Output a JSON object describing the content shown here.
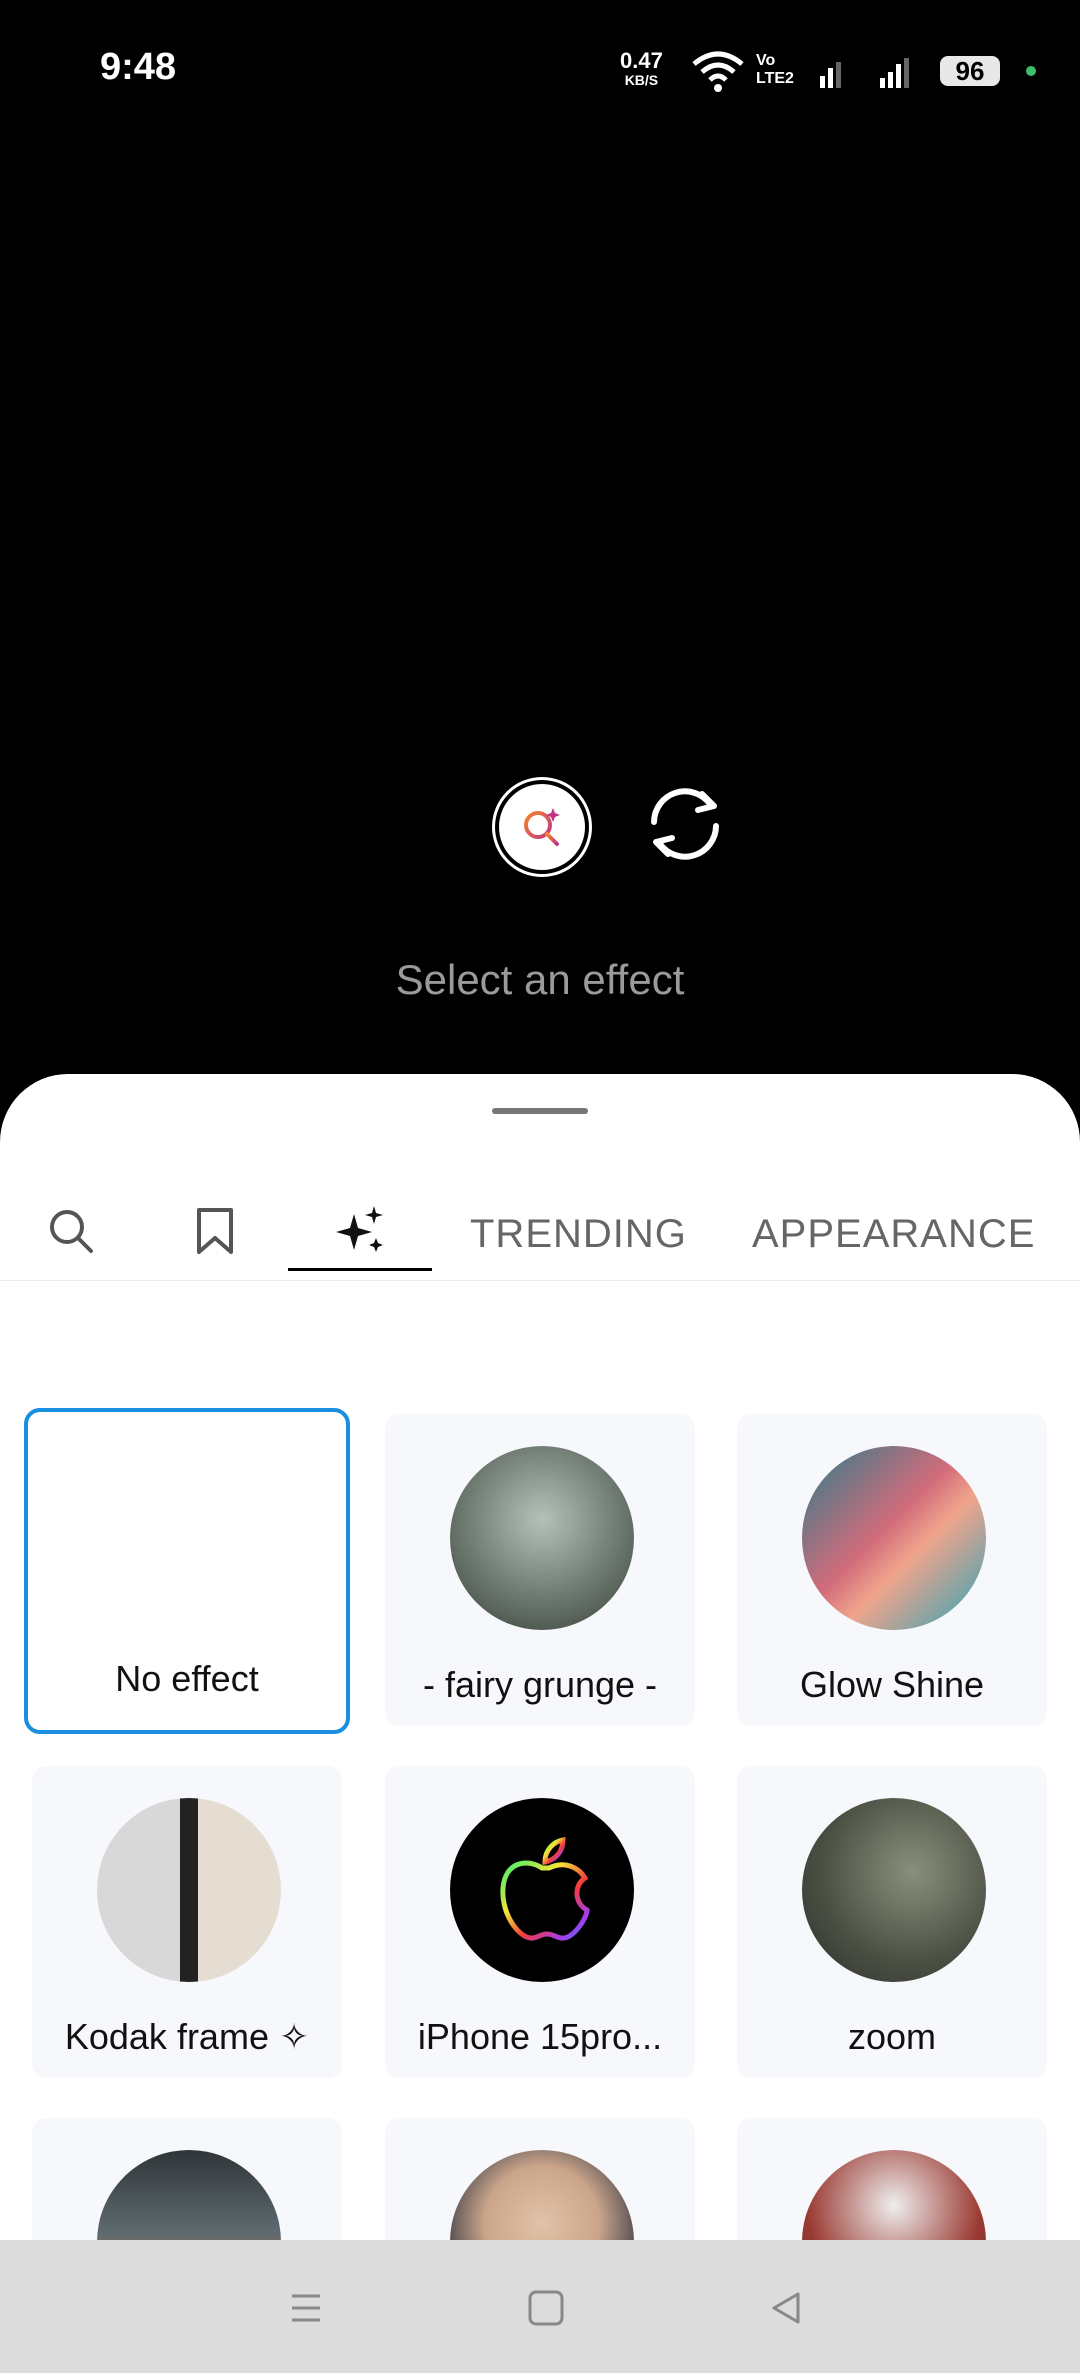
{
  "status_bar": {
    "time": "9:48",
    "net_speed": "0.47",
    "net_unit": "KB/S",
    "volte": "Vo\nLTE2",
    "battery": "96"
  },
  "camera": {
    "effect_button_icon": "effect-search-icon",
    "flip_icon": "flip-camera-icon",
    "select_text": "Select an effect"
  },
  "tabs": {
    "search_icon": "search-icon",
    "saved_icon": "bookmark-icon",
    "sparkle_icon": "sparkle-icon",
    "trending": "TRENDING",
    "appearance": "APPEARANCE"
  },
  "effects": [
    {
      "label": "No effect",
      "selected": true
    },
    {
      "label": "- fairy grunge -",
      "colors": [
        "#8fa39a",
        "#2e3531"
      ]
    },
    {
      "label": "Glow Shine",
      "colors": [
        "#d26b7a",
        "#2a7d8c"
      ]
    },
    {
      "label": "Kodak frame ✧",
      "colors": [
        "#cfcfcf",
        "#222"
      ]
    },
    {
      "label": "iPhone 15pro...",
      "colors": [
        "#111",
        "#000"
      ]
    },
    {
      "label": "zoom",
      "colors": [
        "#6b705e",
        "#2a2d28"
      ]
    },
    {
      "label": "",
      "colors": [
        "#3c4248",
        "#7d6a4f"
      ]
    },
    {
      "label": "",
      "colors": [
        "#caa58a",
        "#2d3240"
      ]
    },
    {
      "label": "",
      "colors": [
        "#9a3a32",
        "#ddd"
      ]
    }
  ],
  "navbar": {
    "menu_icon": "menu-icon",
    "home_icon": "home-square-icon",
    "back_icon": "back-triangle-icon"
  }
}
